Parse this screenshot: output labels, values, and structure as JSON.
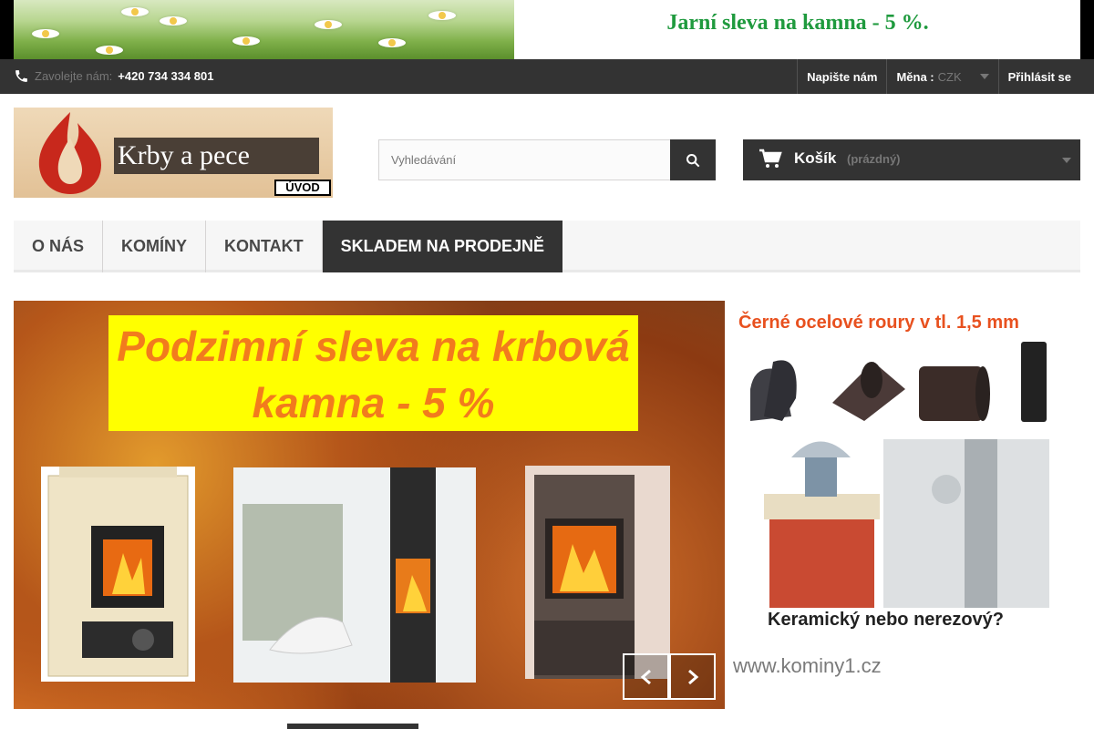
{
  "top_banner": {
    "promo": "Jarní sleva na kamna - 5 %."
  },
  "navbar": {
    "phone_label": "Zavolejte nám:",
    "phone_number": "+420 734 334 801",
    "contact_label": "Napište nám",
    "currency_label": "Měna :",
    "currency_value": "CZK",
    "login_label": "Přihlásit se"
  },
  "logo": {
    "brand": "Krby a pece",
    "home_label": "ÚVOD"
  },
  "search": {
    "placeholder": "Vyhledávání"
  },
  "cart": {
    "title": "Košík",
    "status": "(prázdný)"
  },
  "menu": {
    "items": [
      {
        "label": "O nás"
      },
      {
        "label": "Komíny"
      },
      {
        "label": "Kontakt"
      },
      {
        "label": "Skladem na prodejně"
      }
    ]
  },
  "slider": {
    "headline_line1": "Podzimní sleva na krbová",
    "headline_line2": "kamna - 5 %"
  },
  "side_ad": {
    "title": "Černé ocelové roury v tl. 1,5 mm",
    "bottom_text": "Keramický nebo nerezový?",
    "website": "www.kominy1.cz"
  },
  "colors": {
    "dark": "#333333",
    "accent_orange": "#f27b1d",
    "promo_green": "#1f9a3e"
  }
}
